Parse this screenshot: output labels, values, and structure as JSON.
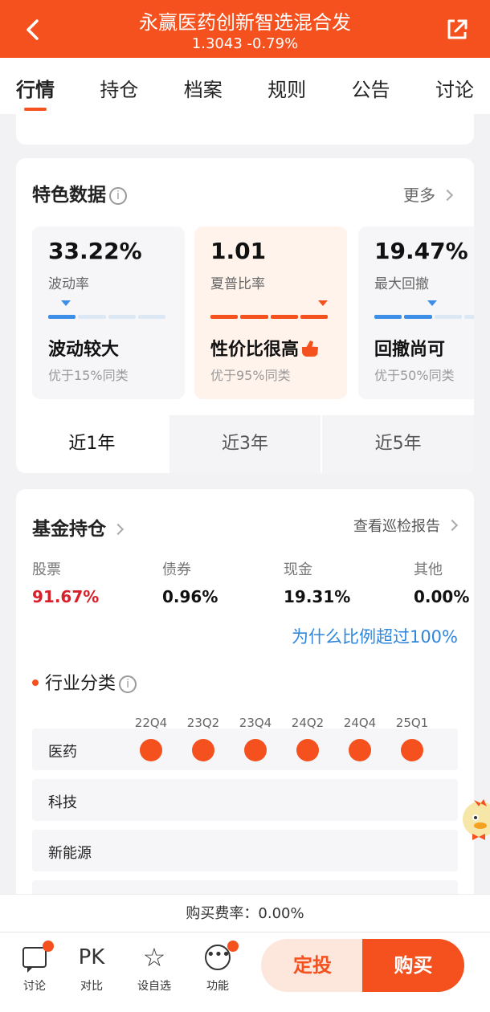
{
  "header": {
    "title": "永赢医药创新智选混合发",
    "subtitle": "1.3043 -0.79%",
    "back_icon": "chevron-left-icon",
    "share_icon": "share-external-icon"
  },
  "tabs": [
    {
      "label": "行情",
      "active": true
    },
    {
      "label": "持仓",
      "active": false
    },
    {
      "label": "档案",
      "active": false
    },
    {
      "label": "规则",
      "active": false
    },
    {
      "label": "公告",
      "active": false
    },
    {
      "label": "讨论",
      "active": false
    }
  ],
  "features": {
    "title": "特色数据",
    "more": "更多",
    "metrics": [
      {
        "value": "33.22%",
        "label": "波动率",
        "verdict": "波动较大",
        "sub": "优于15%同类",
        "level": 0.15
      },
      {
        "value": "1.01",
        "label": "夏普比率",
        "verdict": "性价比很高",
        "sub": "优于95%同类",
        "level": 0.95
      },
      {
        "value": "19.47%",
        "label": "最大回撤",
        "verdict": "回撤尚可",
        "sub": "优于50%同类",
        "level": 0.5
      }
    ],
    "periods": [
      {
        "label": "近1年",
        "active": true
      },
      {
        "label": "近3年",
        "active": false
      },
      {
        "label": "近5年",
        "active": false
      }
    ]
  },
  "holdings": {
    "title": "基金持仓",
    "report": "查看巡检报告",
    "allocation": [
      {
        "label": "股票",
        "value": "91.67%"
      },
      {
        "label": "债券",
        "value": "0.96%"
      },
      {
        "label": "现金",
        "value": "19.31%"
      },
      {
        "label": "其他",
        "value": "0.00%"
      }
    ],
    "why": "为什么比例超过100%",
    "industry_title": "行业分类",
    "quarters": [
      "22Q4",
      "23Q2",
      "23Q4",
      "24Q2",
      "24Q4",
      "25Q1"
    ],
    "industries": [
      {
        "name": "医药",
        "present": [
          true,
          true,
          true,
          true,
          true,
          true
        ]
      },
      {
        "name": "科技",
        "present": [
          false,
          false,
          false,
          false,
          false,
          false
        ]
      },
      {
        "name": "新能源",
        "present": [
          false,
          false,
          false,
          false,
          false,
          false
        ]
      }
    ]
  },
  "fee": "购买费率：0.00%",
  "bottom": {
    "items": [
      {
        "label": "讨论",
        "icon": "chat-bubble-icon",
        "badge": true
      },
      {
        "label": "对比",
        "icon": "PK",
        "badge": false
      },
      {
        "label": "设自选",
        "icon": "star-add-icon",
        "badge": false
      },
      {
        "label": "功能",
        "icon": "more-dots-icon",
        "badge": true
      }
    ],
    "sip": "定投",
    "buy": "购买"
  },
  "colors": {
    "accent": "#f4511e",
    "link": "#2f86dd",
    "up_red": "#d8202a"
  }
}
